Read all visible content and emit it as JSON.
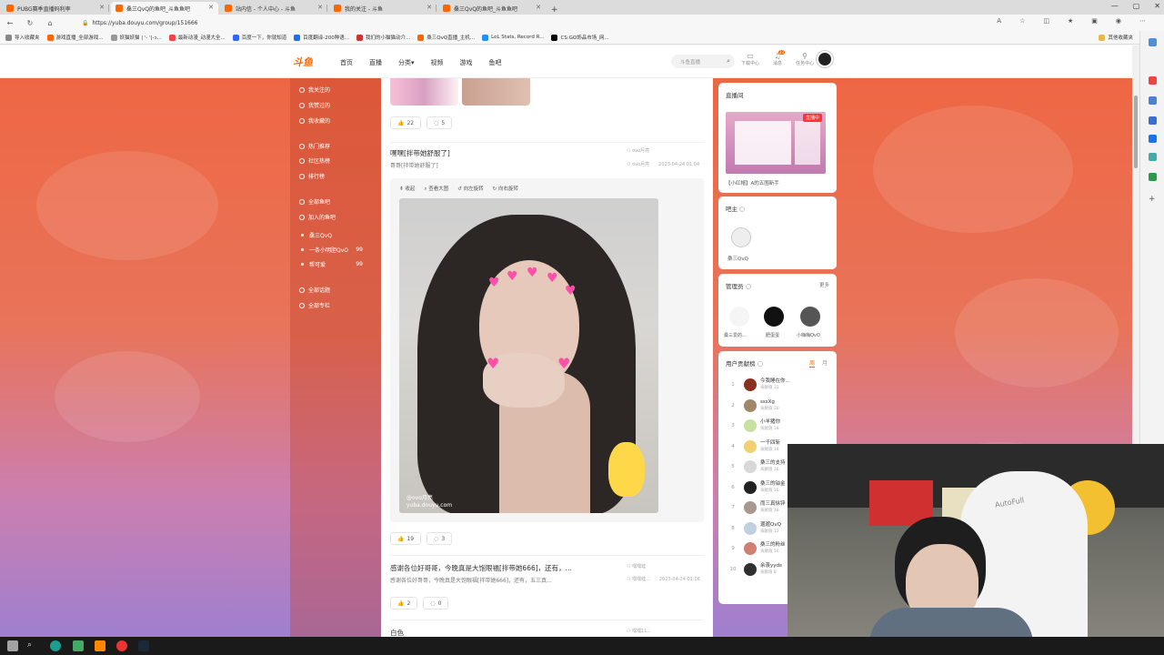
{
  "browser": {
    "tabs": [
      {
        "label": "PUBG赛季直播码利率",
        "active": false
      },
      {
        "label": "桑三QvQ的鱼吧_斗鱼鱼吧",
        "active": true
      },
      {
        "label": "站内信 - 个人中心 - 斗鱼",
        "active": false
      },
      {
        "label": "我的关注 - 斗鱼",
        "active": false
      },
      {
        "label": "桑三QvQ的鱼吧_斗鱼鱼吧",
        "active": false
      }
    ],
    "new_tab": "+",
    "url": "https://yuba.douyu.com/group/151666",
    "bookmarks": [
      "导入收藏夹",
      "游戏直播_全部游戏...",
      "妖猫妖猫 | '- '|-ɔ...",
      "最新动漫_动漫大全...",
      "百度一下，你就知道",
      "百度翻译-200种语...",
      "我们的小猫猫动介...",
      "桑三QvQ直播_主机...",
      "LoL Stats, Record R...",
      "CS:GO饰品市场_网..."
    ],
    "other_bookmarks": "其他收藏夹"
  },
  "site": {
    "logo": "斗鱼",
    "nav": [
      "首页",
      "直播",
      "分类",
      "视频",
      "游戏",
      "鱼吧"
    ],
    "search_placeholder": "斗鱼直播",
    "header_icons": [
      {
        "label": "下载中心",
        "icon": "download-icon"
      },
      {
        "label": "消息",
        "icon": "bell-icon",
        "badge": "23"
      },
      {
        "label": "任务中心",
        "icon": "location-icon"
      }
    ]
  },
  "left_nav": {
    "groups": [
      [
        "我关注的",
        "我赞过的",
        "我收藏的"
      ],
      [
        "热门推荐",
        "社区热榜",
        "排行榜"
      ],
      [
        "全部鱼吧",
        "加入的鱼吧"
      ]
    ],
    "joined": [
      {
        "name": "桑三QvQ",
        "count": ""
      },
      {
        "name": "一条小明胆QvO",
        "count": "99"
      },
      {
        "name": "帮可爱",
        "count": "99"
      }
    ],
    "bottom": [
      "全部话题",
      "全部专栏"
    ]
  },
  "feed": {
    "post0": {
      "likes": "22",
      "comments": "5"
    },
    "post1": {
      "title": "嘿嘿[拌带她舒服了]",
      "subtitle": "哥哥[拌带她舒服了]",
      "author": "ovo月亮",
      "author2": "ovo月亮",
      "time": "2023-04-24 01:04",
      "toolbar": [
        "收起",
        "查看大图",
        "向左旋转",
        "向右旋转"
      ],
      "watermark": [
        "@ovo月亮",
        "yuba.douyu.com"
      ],
      "likes": "19",
      "comments": "3"
    },
    "post2": {
      "title": "感谢各位好哥哥，今晚真是大饱眼福[拌带她666]，还有，...",
      "subtitle": "感谢各位好哥哥，今晚真是大饱眼福[拌带她666]，还有，五三真...",
      "author": "嘿嘿蛙",
      "author2": "嘿嘿蛙...",
      "time": "2023-04-24 01:06",
      "likes": "2",
      "comments": "0"
    },
    "post3": {
      "title": "白色",
      "author": "嘿嘿11..."
    }
  },
  "right_rail": {
    "live": {
      "title": "直播间",
      "badge": "直播中",
      "caption": "【小红帽】A的五围新手"
    },
    "owner": {
      "title": "吧主",
      "name": "桑三QvQ"
    },
    "admins": {
      "title": "管理员",
      "more": "更多",
      "list": [
        "桑三爱的...",
        "肥蛋蛋",
        "小嗨嗨QvO"
      ]
    },
    "rank": {
      "title": "用户贡献榜",
      "tabs": [
        "周",
        "月"
      ],
      "rows": [
        {
          "n": "1",
          "name": "今我睡在你...",
          "lv": "贡献值 31",
          "color": "#8a3020"
        },
        {
          "n": "2",
          "name": "sssXg",
          "lv": "贡献值 20",
          "color": "#a0896a"
        },
        {
          "n": "3",
          "name": "小羊猪你",
          "lv": "贡献值 18",
          "color": "#c8e0a0"
        },
        {
          "n": "4",
          "name": "一千四斩",
          "lv": "贡献值 18",
          "color": "#f0d070"
        },
        {
          "n": "5",
          "name": "桑三的支持",
          "lv": "贡献值 16",
          "color": "#d8d8d8"
        },
        {
          "n": "6",
          "name": "桑三的铂金",
          "lv": "贡献值 16",
          "color": "#222222"
        },
        {
          "n": "7",
          "name": "而三真徐锌",
          "lv": "贡献值 16",
          "color": "#a89890"
        },
        {
          "n": "8",
          "name": "遛遛QvQ",
          "lv": "贡献值 12",
          "color": "#c0d0e0"
        },
        {
          "n": "9",
          "name": "桑三的粉丝",
          "lv": "贡献值 10",
          "color": "#d08070"
        },
        {
          "n": "10",
          "name": "余羡yyds",
          "lv": "贡献值 8",
          "color": "#303030"
        }
      ]
    }
  },
  "webcam": {
    "chair_text": "AutoFull"
  },
  "colors": {
    "brand": "#ff6600",
    "accent_orange": "#ee6744",
    "accent_purple": "#9f7fcf"
  }
}
